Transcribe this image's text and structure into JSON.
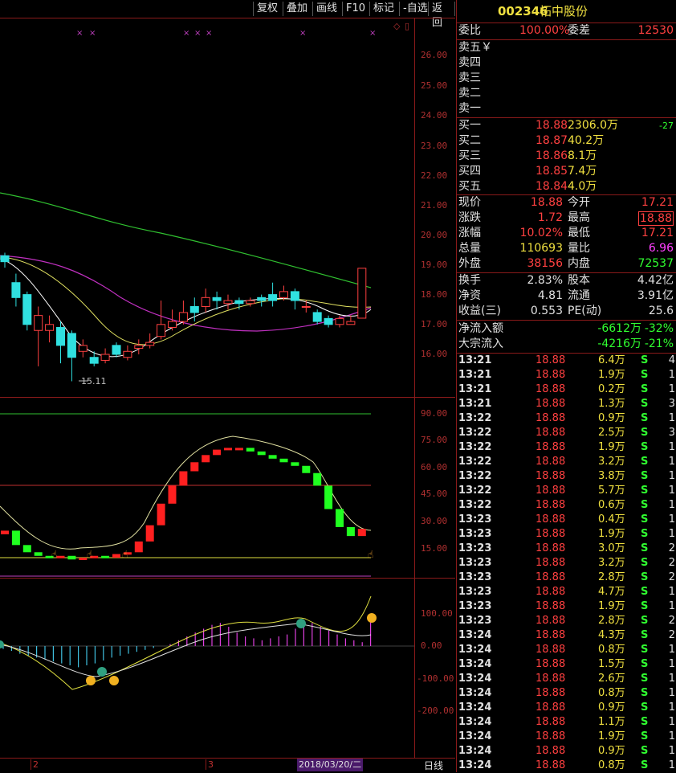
{
  "toolbar": {
    "buttons": [
      "复权",
      "叠加",
      "画线",
      "F10",
      "标记",
      "-自选",
      "返回"
    ]
  },
  "price_axis": [
    "26.00",
    "25.00",
    "24.00",
    "23.00",
    "22.00",
    "21.00",
    "20.00",
    "19.00",
    "18.00",
    "17.00",
    "16.00"
  ],
  "low_label": "15.11",
  "kdj_axis": [
    "90.00",
    "75.00",
    "60.00",
    "45.00",
    "30.00",
    "15.00"
  ],
  "macd_axis": [
    "100.00",
    "0.00",
    "-100.00",
    "-200.00"
  ],
  "bottom": {
    "marks": [
      "2",
      "3"
    ],
    "date": "2018/03/20/二",
    "period": "日线"
  },
  "stock": {
    "code": "002346",
    "name": "柘中股份"
  },
  "order": {
    "ratio_label": "委比",
    "ratio": "100.00%",
    "diff_label": "委差",
    "diff": "12530",
    "sells": [
      {
        "label": "卖五￥"
      },
      {
        "label": "卖四"
      },
      {
        "label": "卖三"
      },
      {
        "label": "卖二"
      },
      {
        "label": "卖一"
      }
    ],
    "buys": [
      {
        "label": "买一",
        "price": "18.88",
        "vol": "2306.0万",
        "chg": "-27"
      },
      {
        "label": "买二",
        "price": "18.87",
        "vol": "40.2万",
        "chg": ""
      },
      {
        "label": "买三",
        "price": "18.86",
        "vol": "8.1万",
        "chg": ""
      },
      {
        "label": "买四",
        "price": "18.85",
        "vol": "7.4万",
        "chg": ""
      },
      {
        "label": "买五",
        "price": "18.84",
        "vol": "4.0万",
        "chg": ""
      }
    ]
  },
  "quote": {
    "rows": [
      {
        "l1": "现价",
        "v1": "18.88",
        "l2": "今开",
        "v2": "17.21"
      },
      {
        "l1": "涨跌",
        "v1": "1.72",
        "l2": "最高",
        "v2": "18.88"
      },
      {
        "l1": "涨幅",
        "v1": "10.02%",
        "l2": "最低",
        "v2": "17.21"
      },
      {
        "l1": "总量",
        "v1": "110693",
        "l2": "量比",
        "v2": "6.96"
      },
      {
        "l1": "外盘",
        "v1": "38156",
        "l2": "内盘",
        "v2": "72537"
      }
    ],
    "rows2": [
      {
        "l1": "换手",
        "v1": "2.83%",
        "l2": "股本",
        "v2": "4.42亿"
      },
      {
        "l1": "净资",
        "v1": "4.81",
        "l2": "流通",
        "v2": "3.91亿"
      },
      {
        "l1": "收益(三)",
        "v1": "0.553",
        "l2": "PE(动)",
        "v2": "25.6"
      }
    ],
    "flow": [
      {
        "label": "净流入额",
        "value": "-6612万",
        "pct": "-32%"
      },
      {
        "label": "大宗流入",
        "value": "-4216万",
        "pct": "-21%"
      }
    ]
  },
  "ticks": [
    {
      "t": "13:21",
      "p": "18.88",
      "v": "6.4万",
      "s": "S",
      "n": "4"
    },
    {
      "t": "13:21",
      "p": "18.88",
      "v": "1.9万",
      "s": "S",
      "n": "1"
    },
    {
      "t": "13:21",
      "p": "18.88",
      "v": "0.2万",
      "s": "S",
      "n": "1"
    },
    {
      "t": "13:21",
      "p": "18.88",
      "v": "1.3万",
      "s": "S",
      "n": "3"
    },
    {
      "t": "13:22",
      "p": "18.88",
      "v": "0.9万",
      "s": "S",
      "n": "1"
    },
    {
      "t": "13:22",
      "p": "18.88",
      "v": "2.5万",
      "s": "S",
      "n": "3"
    },
    {
      "t": "13:22",
      "p": "18.88",
      "v": "1.9万",
      "s": "S",
      "n": "1"
    },
    {
      "t": "13:22",
      "p": "18.88",
      "v": "3.2万",
      "s": "S",
      "n": "1"
    },
    {
      "t": "13:22",
      "p": "18.88",
      "v": "3.8万",
      "s": "S",
      "n": "1"
    },
    {
      "t": "13:22",
      "p": "18.88",
      "v": "5.7万",
      "s": "S",
      "n": "1"
    },
    {
      "t": "13:22",
      "p": "18.88",
      "v": "0.6万",
      "s": "S",
      "n": "1"
    },
    {
      "t": "13:23",
      "p": "18.88",
      "v": "0.4万",
      "s": "S",
      "n": "1"
    },
    {
      "t": "13:23",
      "p": "18.88",
      "v": "1.9万",
      "s": "S",
      "n": "1"
    },
    {
      "t": "13:23",
      "p": "18.88",
      "v": "3.0万",
      "s": "S",
      "n": "2"
    },
    {
      "t": "13:23",
      "p": "18.88",
      "v": "3.2万",
      "s": "S",
      "n": "2"
    },
    {
      "t": "13:23",
      "p": "18.88",
      "v": "2.8万",
      "s": "S",
      "n": "2"
    },
    {
      "t": "13:23",
      "p": "18.88",
      "v": "4.7万",
      "s": "S",
      "n": "1"
    },
    {
      "t": "13:23",
      "p": "18.88",
      "v": "1.9万",
      "s": "S",
      "n": "1"
    },
    {
      "t": "13:23",
      "p": "18.88",
      "v": "2.8万",
      "s": "S",
      "n": "2"
    },
    {
      "t": "13:24",
      "p": "18.88",
      "v": "4.3万",
      "s": "S",
      "n": "2"
    },
    {
      "t": "13:24",
      "p": "18.88",
      "v": "0.8万",
      "s": "S",
      "n": "1"
    },
    {
      "t": "13:24",
      "p": "18.88",
      "v": "1.5万",
      "s": "S",
      "n": "1"
    },
    {
      "t": "13:24",
      "p": "18.88",
      "v": "2.6万",
      "s": "S",
      "n": "1"
    },
    {
      "t": "13:24",
      "p": "18.88",
      "v": "0.8万",
      "s": "S",
      "n": "1"
    },
    {
      "t": "13:24",
      "p": "18.88",
      "v": "0.9万",
      "s": "S",
      "n": "1"
    },
    {
      "t": "13:24",
      "p": "18.88",
      "v": "1.1万",
      "s": "S",
      "n": "1"
    },
    {
      "t": "13:24",
      "p": "18.88",
      "v": "1.9万",
      "s": "S",
      "n": "1"
    },
    {
      "t": "13:24",
      "p": "18.88",
      "v": "0.9万",
      "s": "S",
      "n": "1"
    },
    {
      "t": "13:24",
      "p": "18.88",
      "v": "0.8万",
      "s": "S",
      "n": "1"
    }
  ],
  "candles": [
    {
      "o": 19.3,
      "c": 19.1,
      "h": 19.4,
      "l": 18.9
    },
    {
      "o": 18.4,
      "c": 17.9,
      "h": 18.7,
      "l": 17.6
    },
    {
      "o": 18.0,
      "c": 17.0,
      "h": 18.1,
      "l": 16.8
    },
    {
      "o": 16.8,
      "c": 17.3,
      "h": 17.6,
      "l": 15.6
    },
    {
      "o": 16.8,
      "c": 17.0,
      "h": 17.3,
      "l": 16.4
    },
    {
      "o": 16.9,
      "c": 16.3,
      "h": 17.1,
      "l": 15.7
    },
    {
      "o": 16.7,
      "c": 15.9,
      "h": 16.8,
      "l": 15.1
    },
    {
      "o": 16.1,
      "c": 16.3,
      "h": 16.5,
      "l": 15.9
    },
    {
      "o": 15.9,
      "c": 15.7,
      "h": 16.1,
      "l": 15.6
    },
    {
      "o": 15.8,
      "c": 16.0,
      "h": 16.2,
      "l": 15.7
    },
    {
      "o": 16.3,
      "c": 16.0,
      "h": 16.4,
      "l": 15.9
    },
    {
      "o": 15.9,
      "c": 16.1,
      "h": 16.3,
      "l": 15.8
    },
    {
      "o": 16.2,
      "c": 16.3,
      "h": 16.5,
      "l": 16.0
    },
    {
      "o": 16.3,
      "c": 16.4,
      "h": 16.7,
      "l": 16.2
    },
    {
      "o": 16.6,
      "c": 17.0,
      "h": 17.8,
      "l": 16.5
    },
    {
      "o": 16.9,
      "c": 17.1,
      "h": 17.5,
      "l": 16.8
    },
    {
      "o": 17.1,
      "c": 17.4,
      "h": 17.8,
      "l": 17.0
    },
    {
      "o": 17.6,
      "c": 17.4,
      "h": 17.9,
      "l": 17.1
    },
    {
      "o": 17.6,
      "c": 17.9,
      "h": 18.2,
      "l": 17.4
    },
    {
      "o": 17.9,
      "c": 17.8,
      "h": 18.1,
      "l": 17.5
    },
    {
      "o": 17.7,
      "c": 17.8,
      "h": 18.0,
      "l": 17.5
    },
    {
      "o": 17.8,
      "c": 17.7,
      "h": 17.9,
      "l": 17.5
    },
    {
      "o": 17.7,
      "c": 17.8,
      "h": 17.9,
      "l": 17.6
    },
    {
      "o": 17.9,
      "c": 17.8,
      "h": 18.0,
      "l": 17.6
    },
    {
      "o": 18.0,
      "c": 17.8,
      "h": 18.4,
      "l": 17.6
    },
    {
      "o": 17.9,
      "c": 18.1,
      "h": 18.3,
      "l": 17.8
    },
    {
      "o": 18.1,
      "c": 17.8,
      "h": 18.2,
      "l": 17.5
    },
    {
      "o": 17.6,
      "c": 17.6,
      "h": 17.8,
      "l": 17.4
    },
    {
      "o": 17.4,
      "c": 17.1,
      "h": 17.5,
      "l": 17.0
    },
    {
      "o": 17.2,
      "c": 17.0,
      "h": 17.3,
      "l": 16.9
    },
    {
      "o": 17.0,
      "c": 17.2,
      "h": 17.3,
      "l": 16.9
    },
    {
      "o": 17.0,
      "c": 17.1,
      "h": 17.3,
      "l": 17.0
    },
    {
      "o": 17.21,
      "c": 18.88,
      "h": 18.88,
      "l": 17.21
    }
  ]
}
